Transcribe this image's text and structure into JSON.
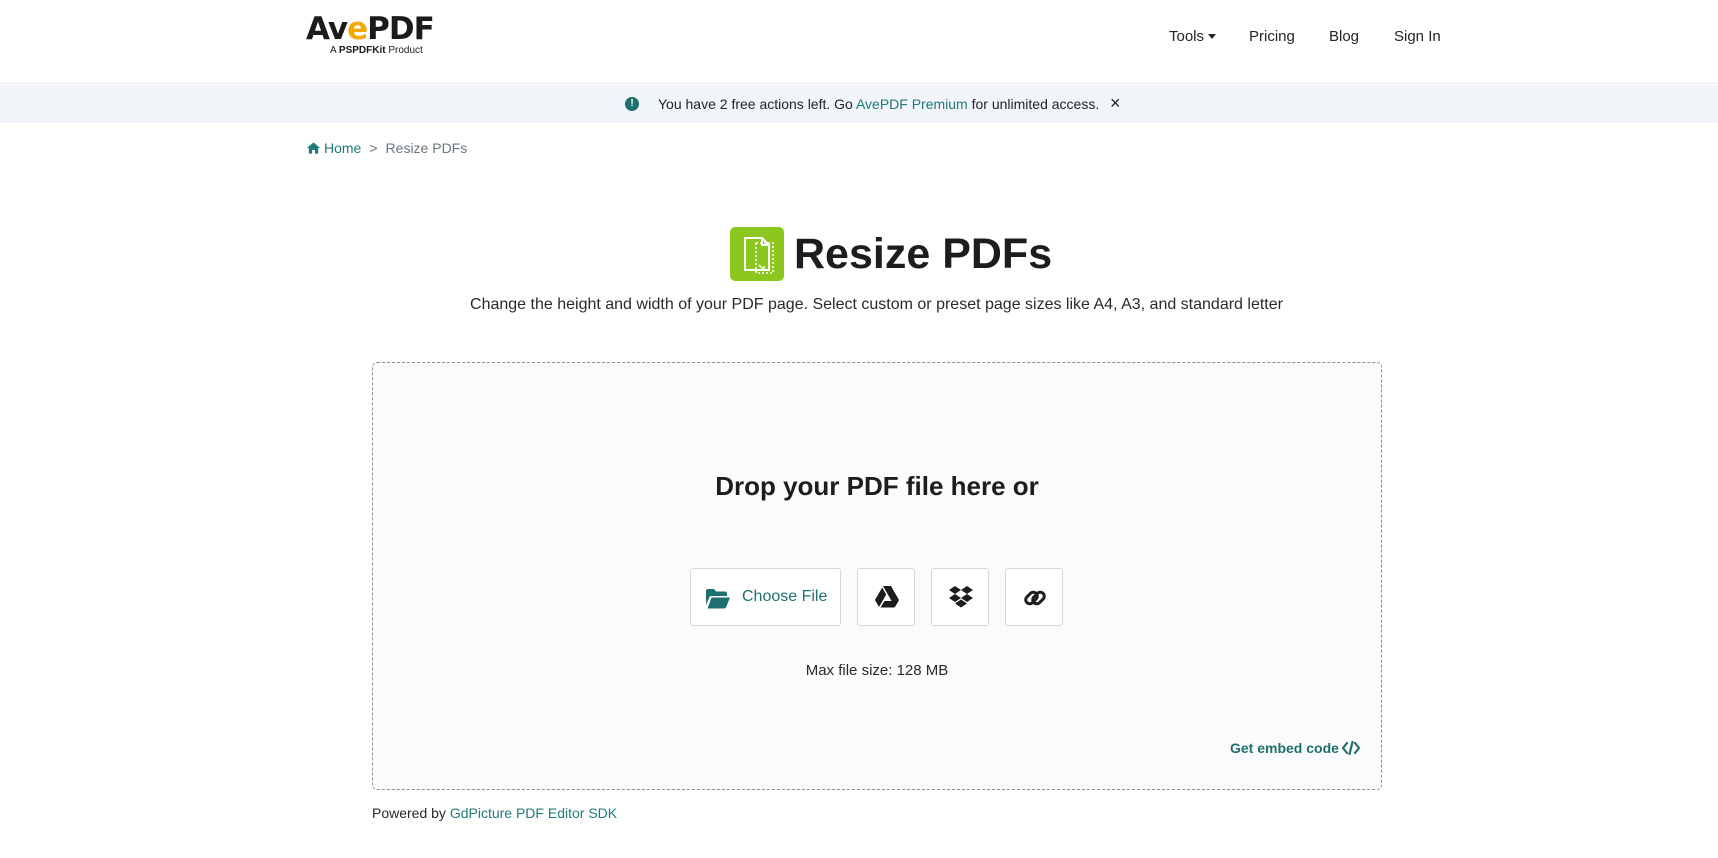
{
  "header": {
    "logo": {
      "text_pre": "Av",
      "text_e": "e",
      "text_post": "PDF",
      "sub_pre": "A ",
      "sub_bold": "PSPDFKit",
      "sub_post": " Product"
    },
    "nav": {
      "tools": "Tools",
      "pricing": "Pricing",
      "blog": "Blog",
      "sign_in": "Sign In"
    }
  },
  "banner": {
    "icon": "exclamation-circle-icon",
    "text_before": "You have 2 free actions left. Go ",
    "link": "AvePDF Premium",
    "text_after": " for unlimited access.",
    "close": "×"
  },
  "breadcrumb": {
    "home": "Home",
    "separator": ">",
    "current": "Resize PDFs"
  },
  "page": {
    "title": "Resize PDFs",
    "subtitle": "Change the height and width of your PDF page. Select custom or preset page sizes like A4, A3, and standard letter"
  },
  "dropzone": {
    "title": "Drop your PDF file here or",
    "choose_file": "Choose File",
    "icons": [
      "folder-open-icon",
      "google-drive-icon",
      "dropbox-icon",
      "link-icon"
    ],
    "max_size": "Max file size: 128 MB",
    "embed": "Get embed code"
  },
  "footer": {
    "powered_by": "Powered by ",
    "powered_link": "GdPicture PDF Editor SDK"
  },
  "colors": {
    "accent": "#1f7a7a",
    "title_icon": "#8bc71f",
    "banner_bg": "#f1f4f9",
    "logo_e": "#f2a900"
  }
}
